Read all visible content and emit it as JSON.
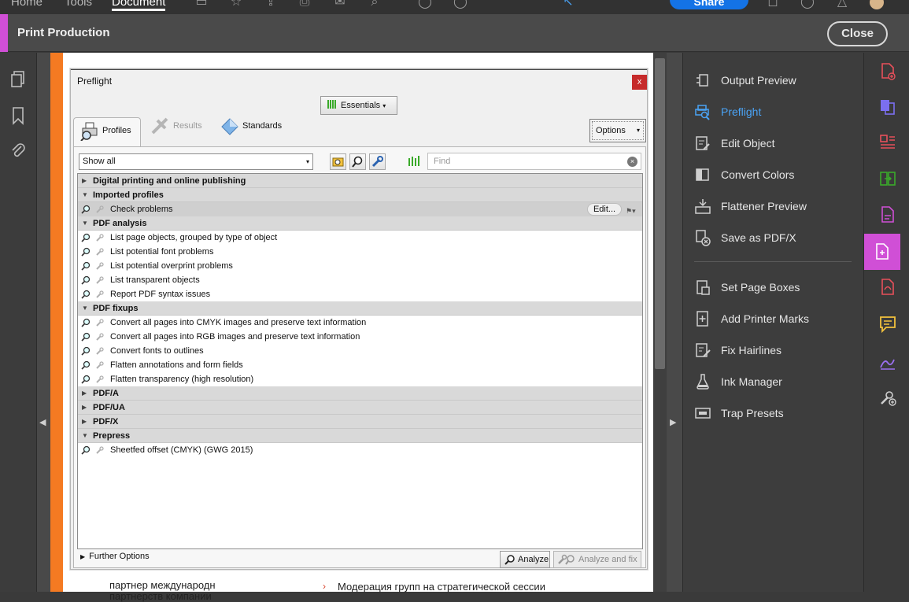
{
  "topbar": {
    "tabs": [
      "Home",
      "Tools",
      "Document"
    ],
    "active_tab": "Document",
    "share_label": "Share",
    "page_number": ""
  },
  "tool": {
    "title": "Print Production",
    "close_label": "Close",
    "accent_color": "#d04fd6"
  },
  "dialog": {
    "title": "Preflight",
    "close_glyph": "x",
    "essentials_label": "Essentials",
    "tabs": {
      "profiles": "Profiles",
      "results": "Results",
      "standards": "Standards"
    },
    "options_label": "Options",
    "filter_value": "Show all",
    "find_placeholder": "Find",
    "groups": [
      {
        "label": "Digital printing and online publishing",
        "expanded": false
      },
      {
        "label": "Imported profiles",
        "expanded": true
      },
      {
        "label": "PDF analysis",
        "expanded": true
      },
      {
        "label": "PDF fixups",
        "expanded": true
      },
      {
        "label": "PDF/A",
        "expanded": false
      },
      {
        "label": "PDF/UA",
        "expanded": false
      },
      {
        "label": "PDF/X",
        "expanded": false
      },
      {
        "label": "Prepress",
        "expanded": true
      }
    ],
    "items": {
      "imported": [
        "Check problems"
      ],
      "analysis": [
        "List page objects, grouped by type of object",
        "List potential font problems",
        "List potential overprint problems",
        "List transparent objects",
        "Report PDF syntax issues"
      ],
      "fixups": [
        "Convert all pages into CMYK images and preserve text information",
        "Convert all pages into RGB images and preserve text information",
        "Convert fonts to outlines",
        "Flatten annotations and form fields",
        "Flatten transparency (high resolution)"
      ],
      "prepress": [
        "Sheetfed offset (CMYK) (GWG 2015)"
      ]
    },
    "edit_label": "Edit...",
    "further_options": "Further Options",
    "analyze_label": "Analyze",
    "analyze_fix_label": "Analyze and fix"
  },
  "background_text": {
    "line1": "партнер международн",
    "line2": "партнерств компании",
    "line3": "Модерация групп на стратегической сессии"
  },
  "right_panel": {
    "items": [
      {
        "label": "Output Preview",
        "active": false
      },
      {
        "label": "Preflight",
        "active": true
      },
      {
        "label": "Edit Object",
        "active": false
      },
      {
        "label": "Convert Colors",
        "active": false
      },
      {
        "label": "Flattener Preview",
        "active": false
      },
      {
        "label": "Save as PDF/X",
        "active": false
      },
      {
        "label": "Set Page Boxes",
        "active": false
      },
      {
        "label": "Add Printer Marks",
        "active": false
      },
      {
        "label": "Fix Hairlines",
        "active": false
      },
      {
        "label": "Ink Manager",
        "active": false
      },
      {
        "label": "Trap Presets",
        "active": false
      }
    ],
    "active_color": "#4aa3f5"
  }
}
